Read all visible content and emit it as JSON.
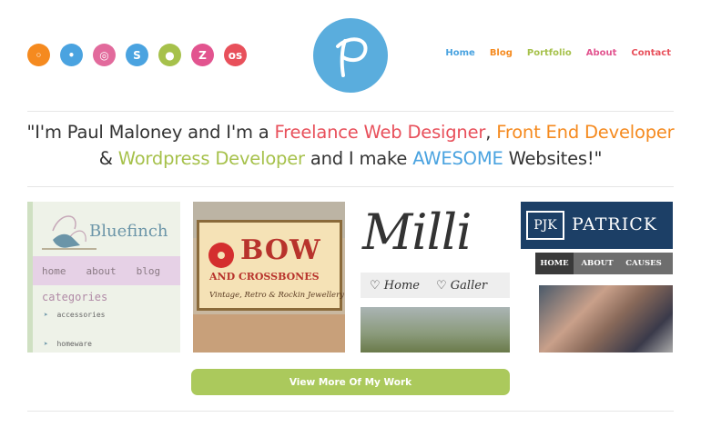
{
  "social": [
    {
      "name": "rss",
      "glyph": "◦",
      "color": "#f58a1f"
    },
    {
      "name": "twitter",
      "glyph": "•",
      "color": "#4aa3e0"
    },
    {
      "name": "dribbble",
      "glyph": "◎",
      "color": "#e26a9c"
    },
    {
      "name": "skype",
      "glyph": "S",
      "color": "#4aa3e0"
    },
    {
      "name": "user",
      "glyph": "●",
      "color": "#a6c14b"
    },
    {
      "name": "zerply",
      "glyph": "Z",
      "color": "#e2548f"
    },
    {
      "name": "lastfm",
      "glyph": "os",
      "color": "#e8505b"
    }
  ],
  "nav": [
    {
      "label": "Home",
      "color": "#4aa3e0"
    },
    {
      "label": "Blog",
      "color": "#f58a1f"
    },
    {
      "label": "Portfolio",
      "color": "#a6c14b"
    },
    {
      "label": "About",
      "color": "#e2548f"
    },
    {
      "label": "Contact",
      "color": "#e8505b"
    }
  ],
  "tagline": {
    "p1": "\"I'm Paul Maloney and I'm a ",
    "h1": "Freelance Web Designer",
    "p2": ", ",
    "h2": "Front End Developer",
    "p3": "& ",
    "h3": "Wordpress Developer",
    "p4": " and I make ",
    "h4": "AWESOME",
    "p5": " Websites!\""
  },
  "portfolio": {
    "bluefinch": {
      "brand": "Bluefinch",
      "nav": [
        "home",
        "about",
        "blog"
      ],
      "heading": "categories",
      "items": [
        "accessories",
        "homeware"
      ]
    },
    "bow": {
      "line1": "BOW",
      "line2": "AND CROSSBONES",
      "tagline": "Vintage, Retro & Rockin Jewellery"
    },
    "milli": {
      "brand": "Milli",
      "nav": [
        "Home",
        "Galler"
      ]
    },
    "patrick": {
      "brand": "PATRICK",
      "mark": "PJK",
      "nav": [
        "HOME",
        "ABOUT",
        "CAUSES"
      ]
    }
  },
  "cta": "View More Of My Work",
  "logo_letter": "P"
}
